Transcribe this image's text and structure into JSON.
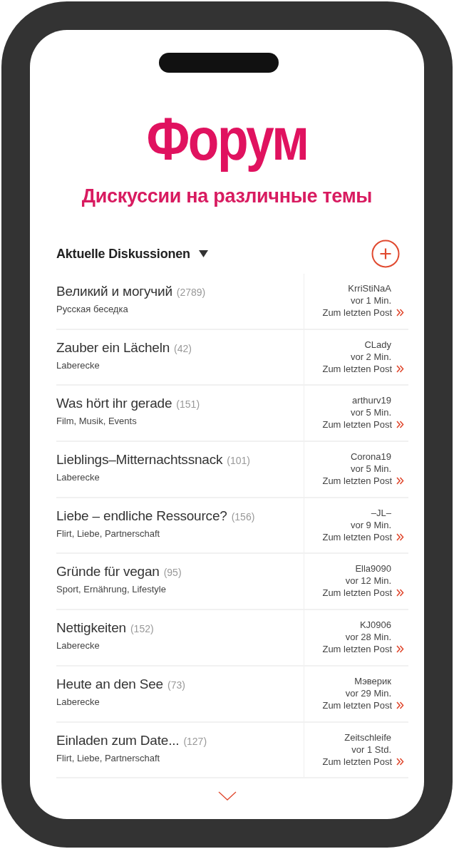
{
  "header": {
    "title": "Форум",
    "subtitle": "Дискуссии на различные темы"
  },
  "section": {
    "title": "Aktuelle Diskussionen",
    "dropdown": true
  },
  "threads": [
    {
      "title": "Великий и могучий",
      "count": "(2789)",
      "category": "Русская беседка",
      "user": "KrriStiNaA",
      "time": "vor 1 Min.",
      "link": "Zum letzten Post"
    },
    {
      "title": "Zauber ein Lächeln",
      "count": "(42)",
      "category": "Laberecke",
      "user": "CLady",
      "time": "vor 2 Min.",
      "link": "Zum letzten Post"
    },
    {
      "title": "Was hört ihr gerade",
      "count": "(151)",
      "category": "Film, Musik, Events",
      "user": "arthurv19",
      "time": "vor 5 Min.",
      "link": "Zum letzten Post"
    },
    {
      "title": "Lieblings–Mitternachtssnack",
      "count": "(101)",
      "category": "Laberecke",
      "user": "Corona19",
      "time": "vor 5 Min.",
      "link": "Zum letzten Post"
    },
    {
      "title": "Liebe – endliche Ressource?",
      "count": "(156)",
      "category": "Flirt, Liebe, Partnerschaft",
      "user": "–JL–",
      "time": "vor 9 Min.",
      "link": "Zum letzten Post"
    },
    {
      "title": "Gründe für vegan",
      "count": "(95)",
      "category": "Sport, Ernährung, Lifestyle",
      "user": "Ella9090",
      "time": "vor 12 Min.",
      "link": "Zum letzten Post"
    },
    {
      "title": "Nettigkeiten",
      "count": "(152)",
      "category": "Laberecke",
      "user": "KJ0906",
      "time": "vor 28 Min.",
      "link": "Zum letzten Post"
    },
    {
      "title": "Heute an den See",
      "count": "(73)",
      "category": "Laberecke",
      "user": "Мэверик",
      "time": "vor 29 Min.",
      "link": "Zum letzten Post"
    },
    {
      "title": "Einladen zum Date...",
      "count": "(127)",
      "category": "Flirt, Liebe, Partnerschaft",
      "user": "Zeitschleife",
      "time": "vor 1 Std.",
      "link": "Zum letzten Post"
    }
  ]
}
